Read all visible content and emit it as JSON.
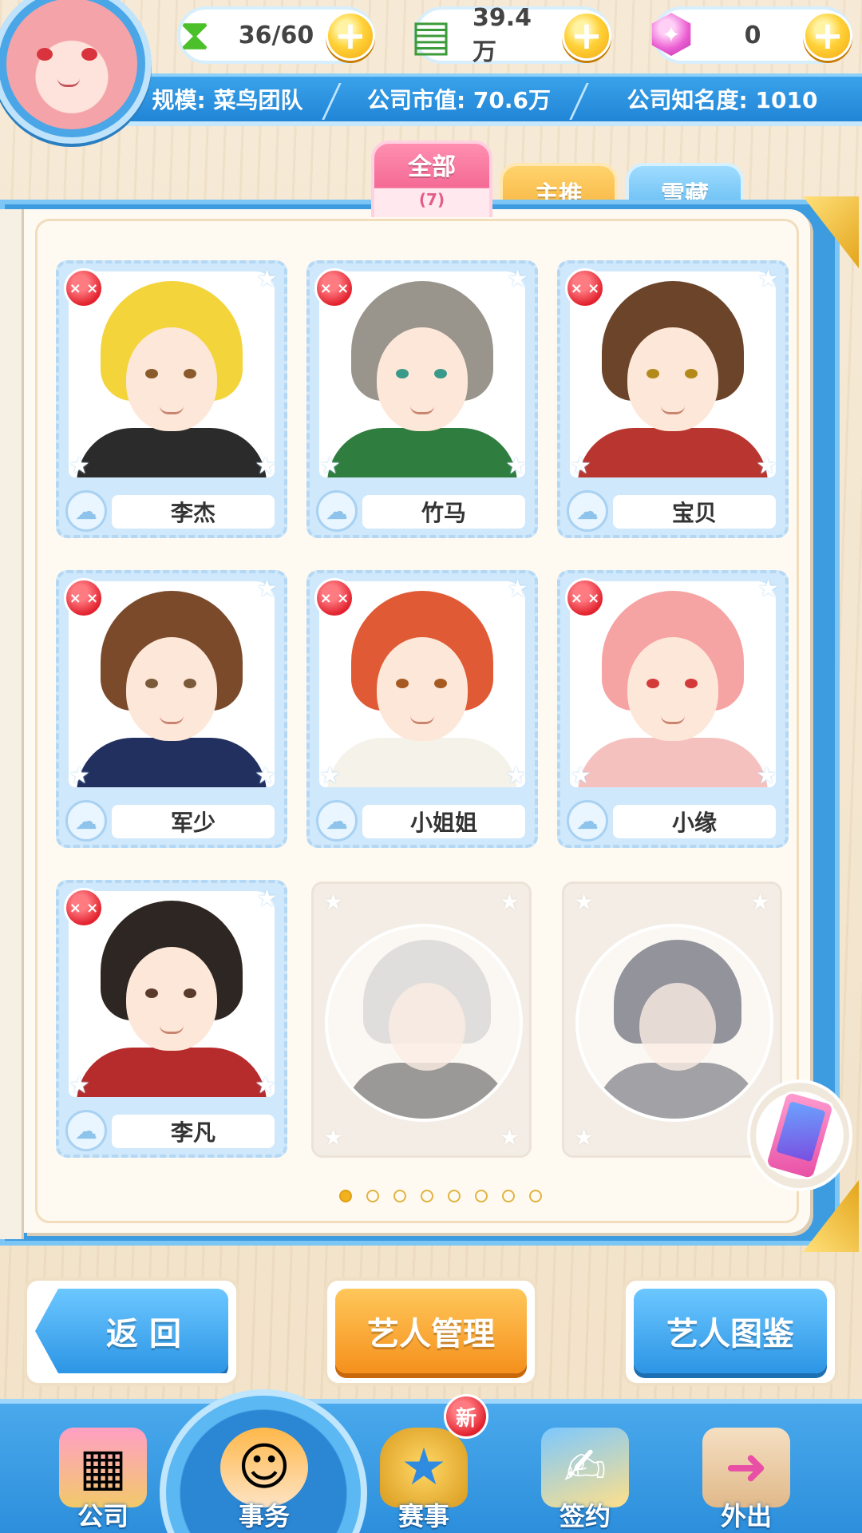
{
  "hud": {
    "energy": {
      "icon": "energy-hourglass-icon",
      "value": "36/60"
    },
    "cash": {
      "icon": "cash-stack-icon",
      "value": "39.4万"
    },
    "gems": {
      "icon": "gem-icon",
      "value": "0"
    },
    "plus_label": "+",
    "scale_label": "规模: 菜鸟团队",
    "market_value_label": "公司市值: 70.6万",
    "fame_label": "公司知名度: 1010"
  },
  "tabs": [
    {
      "label": "全部",
      "count": "(7)",
      "active": true
    },
    {
      "label": "主推",
      "active": false
    },
    {
      "label": "雪藏",
      "active": false
    }
  ],
  "artists": [
    {
      "name": "李杰",
      "mood": "unhappy",
      "hair": "#f3d43a",
      "eye": "#8a5a2a",
      "outfit": "#2b2b2b"
    },
    {
      "name": "竹马",
      "mood": "unhappy",
      "hair": "#9a958c",
      "eye": "#3a9a8a",
      "outfit": "#2f7d3f"
    },
    {
      "name": "宝贝",
      "mood": "unhappy",
      "hair": "#6b4429",
      "eye": "#b38a1a",
      "outfit": "#b8362f"
    },
    {
      "name": "军少",
      "mood": "unhappy",
      "hair": "#7a4a2b",
      "eye": "#7a5a3a",
      "outfit": "#22305f"
    },
    {
      "name": "小姐姐",
      "mood": "unhappy",
      "hair": "#e05a35",
      "eye": "#a65a22",
      "outfit": "#f5f2ea"
    },
    {
      "name": "小缘",
      "mood": "unhappy",
      "hair": "#f6a3a3",
      "eye": "#d33a3a",
      "outfit": "#f5c1bf"
    },
    {
      "name": "李凡",
      "mood": "unhappy",
      "hair": "#2e2622",
      "eye": "#5a3a2a",
      "outfit": "#b62b2b"
    }
  ],
  "locked_slots": [
    {
      "hair": "#c9c9c9",
      "outfit": "#3a3a3a"
    },
    {
      "hair": "#3c3f52",
      "outfit": "#4a4a55"
    }
  ],
  "pager": {
    "total": 8,
    "current": 1
  },
  "buttons": {
    "back": "返 回",
    "manage": "艺人管理",
    "catalog": "艺人图鉴"
  },
  "nav": [
    {
      "label": "公司",
      "icon": "company-building-icon"
    },
    {
      "label": "事务",
      "icon": "affairs-manager-icon",
      "active": true
    },
    {
      "label": "赛事",
      "icon": "trophy-icon",
      "badge": "新"
    },
    {
      "label": "签约",
      "icon": "sign-contract-icon"
    },
    {
      "label": "外出",
      "icon": "door-exit-icon"
    }
  ],
  "mood_glyph": "× ×",
  "cloud_glyph": "☁",
  "star_glyph": "★"
}
